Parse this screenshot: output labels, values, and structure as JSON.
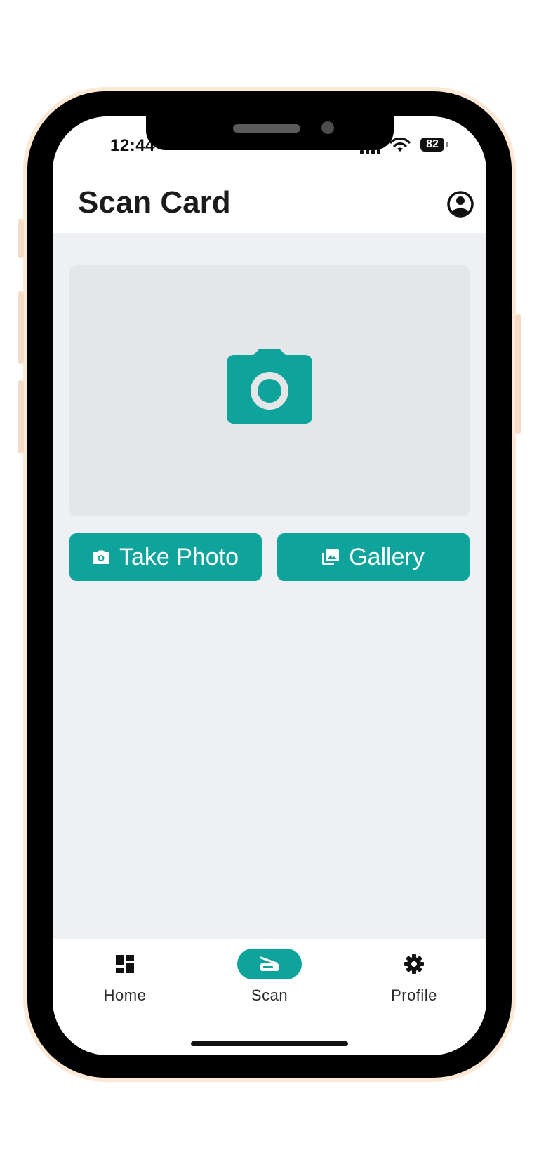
{
  "status_bar": {
    "time": "12:44",
    "battery": "82"
  },
  "header": {
    "title": "Scan Card",
    "account_icon": "account-circle-icon"
  },
  "preview": {
    "icon": "camera-icon"
  },
  "actions": {
    "take_photo": {
      "label": "Take Photo",
      "icon": "camera-icon"
    },
    "gallery": {
      "label": "Gallery",
      "icon": "gallery-icon"
    }
  },
  "bottom_nav": {
    "items": [
      {
        "label": "Home",
        "icon": "dashboard-icon"
      },
      {
        "label": "Scan",
        "icon": "scanner-icon",
        "active": true
      },
      {
        "label": "Profile",
        "icon": "gear-icon"
      }
    ]
  },
  "colors": {
    "accent": "#0ea39b",
    "screen_background": "#eff0f3",
    "preview_background": "#e5e6e8",
    "text_primary": "#1b1b1b",
    "frame": "#fbe8d6"
  }
}
